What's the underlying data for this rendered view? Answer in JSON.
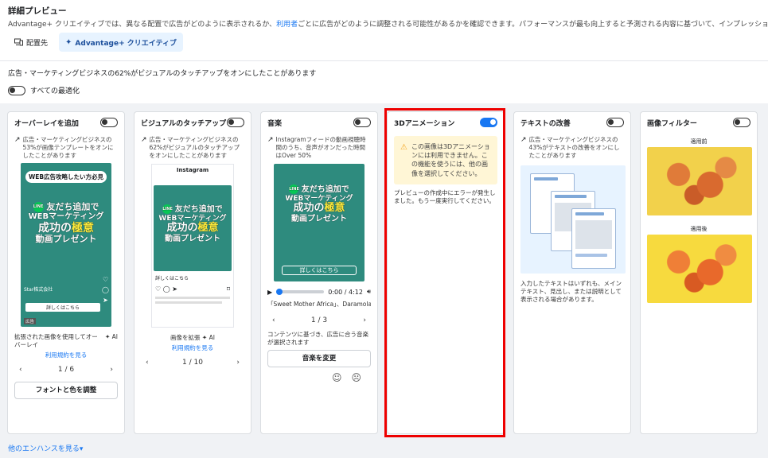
{
  "header": {
    "title": "詳細プレビュー",
    "description_pre": "Advantage+ クリエイティブでは、異なる配置で広告がどのように表示されるか、",
    "description_link": "利用者",
    "description_post": "ごとに広告がどのように調整される可能性があるかを確認できます。パフォーマンスが最も向上すると予測される内容に基づいて、インプレッショ",
    "tabs": [
      {
        "label": "配置先"
      },
      {
        "label": "Advantage+ クリエイティブ"
      }
    ]
  },
  "summary": {
    "stat_text": "広告・マーケティングビジネスの62%がビジュアルのタッチアップをオンにしたことがあります",
    "all_opt_label": "すべての最適化"
  },
  "cards": {
    "overlay": {
      "title": "オーバーレイを追加",
      "note": "広告・マーケティングビジネスの53%が画像テンプレートをオンにしたことがあります",
      "banner": "WEB広告攻略したい方必見",
      "promo1": "友だち追加で",
      "promo2": "WEBマーケティング",
      "promo3a": "成功の",
      "promo3b": "極意",
      "promo4": "動画プレゼント",
      "store": "Star株式会社",
      "cta": "詳しくはこちら",
      "ad_label": "広告",
      "caption": "拡張された画像を使用してオーバーレイ",
      "ai_label": "AI",
      "terms": "利用規約を見る",
      "pager": "1 / 6",
      "button": "フォントと色を調整"
    },
    "touchup": {
      "title": "ビジュアルのタッチアップ",
      "note": "広告・マーケティングビジネスの62%がビジュアルのタッチアップをオンにしたことがあります",
      "ig_label": "Instagram",
      "promo1": "友だち追加で",
      "promo2": "WEBマーケティング",
      "promo3a": "成功の",
      "promo3b": "極意",
      "promo4": "動画プレゼント",
      "cta": "詳しくはこちら",
      "caption": "画像を拡張",
      "ai_label": "AI",
      "terms": "利用規約を見る",
      "pager": "1 / 10"
    },
    "music": {
      "title": "音楽",
      "note": "Instagramフィードの動画視聴時間のうち、音声がオンだった時間はOver 50%",
      "promo1": "友だち追加で",
      "promo2": "WEBマーケティング",
      "promo3a": "成功の",
      "promo3b": "極意",
      "promo4": "動画プレゼント",
      "cta": "詳しくはこちら",
      "time": "0:00 / 4:12",
      "track": "「Sweet Mother Africa」、Daramola",
      "pager": "1 / 3",
      "caption": "コンテンツに基づき、広告に合う音楽が選択されます",
      "button": "音楽を変更"
    },
    "anim3d": {
      "title": "3Dアニメーション",
      "warning": "この画像は3Dアニメーションには利用できません。この機能を使うには、他の画像を選択してください。",
      "error": "プレビューの作成中にエラーが発生しました。もう一度実行してください。"
    },
    "text": {
      "title": "テキストの改善",
      "note": "広告・マーケティングビジネスの43%がテキストの改善をオンにしたことがあります",
      "caption": "入力したテキストはいずれも、メインテキスト、見出し、または説明として表示される場合があります。"
    },
    "filter": {
      "title": "画像フィルター",
      "before_label": "適用前",
      "after_label": "適用後"
    }
  },
  "footer": {
    "more_link": "他のエンハンスを見る"
  }
}
